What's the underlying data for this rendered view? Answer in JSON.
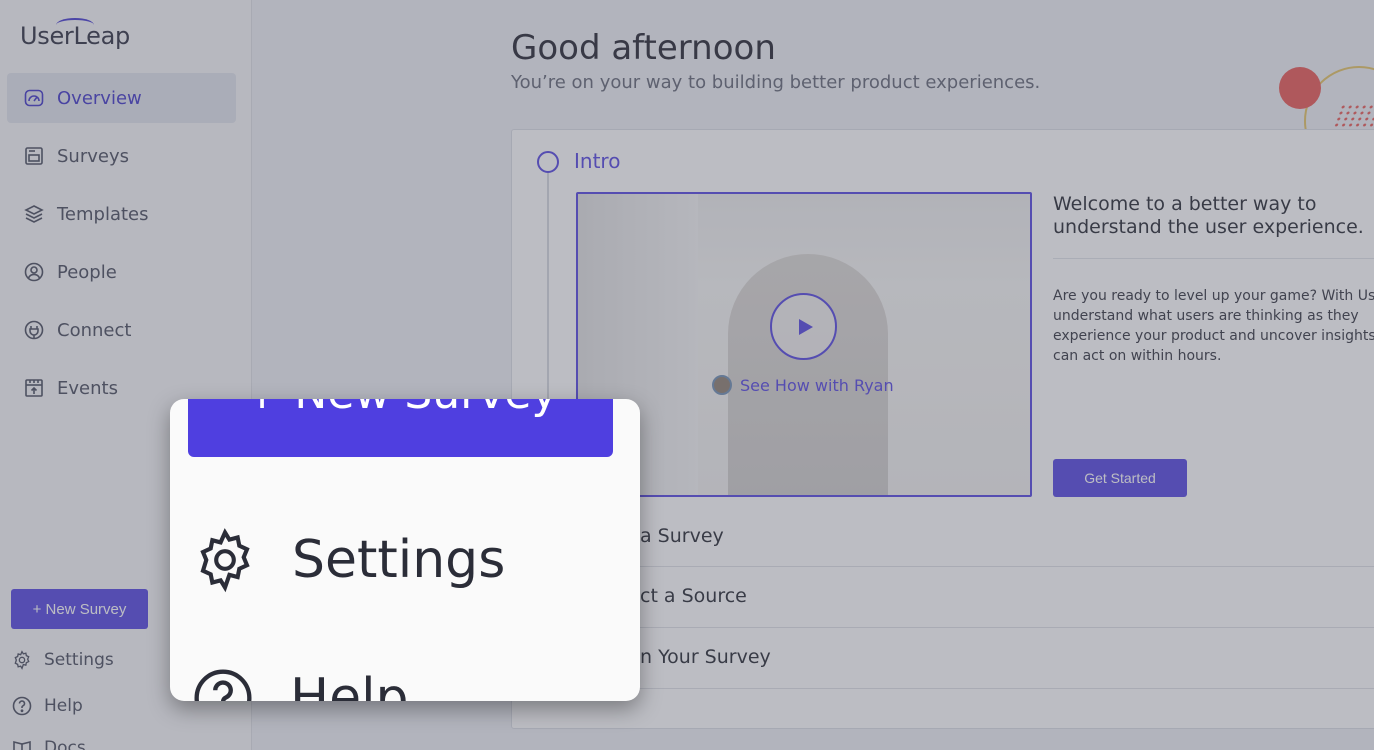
{
  "app": {
    "logo": "UserLeap"
  },
  "sidebar": {
    "items": [
      {
        "label": "Overview",
        "icon": "gauge-icon",
        "active": true
      },
      {
        "label": "Surveys",
        "icon": "survey-icon"
      },
      {
        "label": "Templates",
        "icon": "layers-icon"
      },
      {
        "label": "People",
        "icon": "person-icon"
      },
      {
        "label": "Connect",
        "icon": "plug-icon"
      },
      {
        "label": "Events",
        "icon": "calendar-icon"
      }
    ],
    "new_survey_label": "+ New Survey",
    "settings_label": "Settings",
    "help_label": "Help",
    "docs_label": "Docs"
  },
  "main": {
    "greeting": "Good afternoon",
    "subgreeting": "You’re on your way to building better product experiences.",
    "intro": {
      "title": "Intro",
      "video_cta": "See How with Ryan",
      "welcome": "Welcome to a better way to understand the user experience.",
      "description_lines": [
        "Are you ready to level up your game? With Use",
        "understand what users are thinking as they",
        "experience your product and uncover insights",
        "can act on within hours."
      ],
      "get_started_label": "Get Started"
    },
    "steps": [
      {
        "label": "a Survey"
      },
      {
        "label": "ct a Source"
      },
      {
        "label": "n Your Survey"
      }
    ]
  },
  "zoom": {
    "new_survey_label": "+ New Survey",
    "settings_label": "Settings",
    "help_label": "Help"
  },
  "colors": {
    "accent": "#4f3fe0",
    "deco_red": "#e8524f",
    "deco_yellow": "#e3c25e"
  }
}
